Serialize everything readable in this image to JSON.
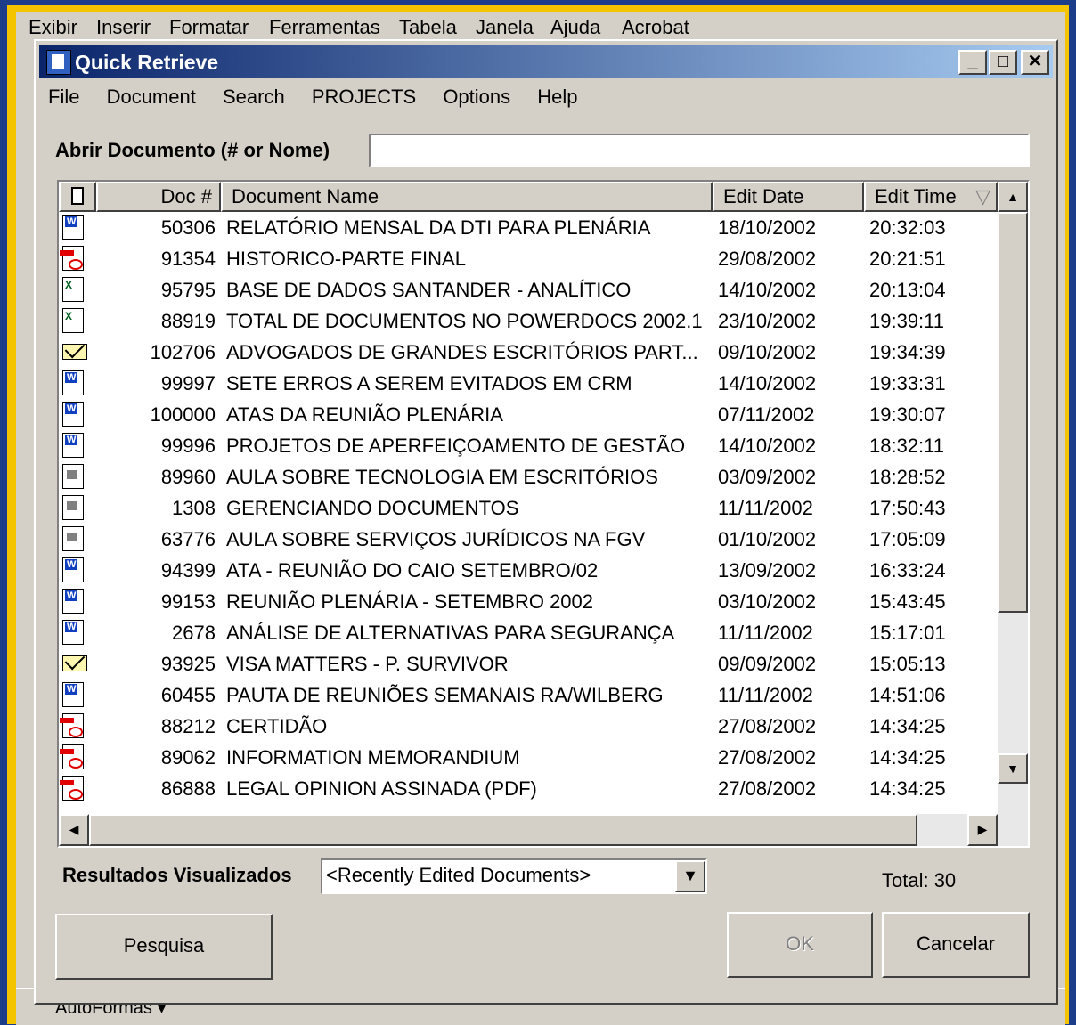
{
  "background": {
    "menu": [
      "Exibir",
      "Inserir",
      "Formatar",
      "Ferramentas",
      "Tabela",
      "Janela",
      "Ajuda",
      "Acrobat"
    ],
    "toolbar_label": "AutoFormas ▾"
  },
  "window": {
    "title": "Quick Retrieve",
    "minimize": "_",
    "maximize": "□",
    "close": "✕"
  },
  "menu": [
    "File",
    "Document",
    "Search",
    "PROJECTS",
    "Options",
    "Help"
  ],
  "open_field": {
    "label": "Abrir Documento (# or Nome)",
    "value": ""
  },
  "table": {
    "columns": [
      "Doc #",
      "Document Name",
      "Edit Date",
      "Edit Time"
    ],
    "sort_indicator": "▽",
    "rows": [
      {
        "icon": "word",
        "num": "50306",
        "name": "RELATÓRIO MENSAL DA DTI PARA PLENÁRIA",
        "date": "18/10/2002",
        "time": "20:32:03"
      },
      {
        "icon": "pdf",
        "num": "91354",
        "name": "HISTORICO-PARTE FINAL",
        "date": "29/08/2002",
        "time": "20:21:51"
      },
      {
        "icon": "xl",
        "num": "95795",
        "name": "BASE DE DADOS SANTANDER - ANALÍTICO",
        "date": "14/10/2002",
        "time": "20:13:04"
      },
      {
        "icon": "xl",
        "num": "88919",
        "name": "TOTAL DE DOCUMENTOS NO POWERDOCS 2002.1",
        "date": "23/10/2002",
        "time": "19:39:11"
      },
      {
        "icon": "mail",
        "num": "102706",
        "name": "ADVOGADOS DE GRANDES ESCRITÓRIOS PART...",
        "date": "09/10/2002",
        "time": "19:34:39"
      },
      {
        "icon": "word",
        "num": "99997",
        "name": "SETE ERROS A SEREM EVITADOS EM CRM",
        "date": "14/10/2002",
        "time": "19:33:31"
      },
      {
        "icon": "word",
        "num": "100000",
        "name": "ATAS DA REUNIÃO PLENÁRIA",
        "date": "07/11/2002",
        "time": "19:30:07"
      },
      {
        "icon": "word",
        "num": "99996",
        "name": "PROJETOS DE APERFEIÇOAMENTO DE GESTÃO",
        "date": "14/10/2002",
        "time": "18:32:11"
      },
      {
        "icon": "gen",
        "num": "89960",
        "name": "AULA SOBRE TECNOLOGIA EM ESCRITÓRIOS",
        "date": "03/09/2002",
        "time": "18:28:52"
      },
      {
        "icon": "gen",
        "num": "1308",
        "name": "GERENCIANDO DOCUMENTOS",
        "date": "11/11/2002",
        "time": "17:50:43"
      },
      {
        "icon": "gen",
        "num": "63776",
        "name": "AULA SOBRE SERVIÇOS JURÍDICOS NA FGV",
        "date": "01/10/2002",
        "time": "17:05:09"
      },
      {
        "icon": "word",
        "num": "94399",
        "name": "ATA - REUNIÃO DO CAIO SETEMBRO/02",
        "date": "13/09/2002",
        "time": "16:33:24"
      },
      {
        "icon": "word",
        "num": "99153",
        "name": "REUNIÃO PLENÁRIA - SETEMBRO 2002",
        "date": "03/10/2002",
        "time": "15:43:45"
      },
      {
        "icon": "word",
        "num": "2678",
        "name": "ANÁLISE DE ALTERNATIVAS PARA SEGURANÇA",
        "date": "11/11/2002",
        "time": "15:17:01"
      },
      {
        "icon": "mail",
        "num": "93925",
        "name": "VISA MATTERS - P. SURVIVOR",
        "date": "09/09/2002",
        "time": "15:05:13"
      },
      {
        "icon": "word",
        "num": "60455",
        "name": "PAUTA DE REUNIÕES SEMANAIS RA/WILBERG",
        "date": "11/11/2002",
        "time": "14:51:06"
      },
      {
        "icon": "pdf",
        "num": "88212",
        "name": "CERTIDÃO",
        "date": "27/08/2002",
        "time": "14:34:25"
      },
      {
        "icon": "pdf",
        "num": "89062",
        "name": "INFORMATION MEMORANDIUM",
        "date": "27/08/2002",
        "time": "14:34:25"
      },
      {
        "icon": "pdf",
        "num": "86888",
        "name": "LEGAL OPINION ASSINADA (PDF)",
        "date": "27/08/2002",
        "time": "14:34:25"
      }
    ]
  },
  "results": {
    "label": "Resultados Visualizados",
    "selected": "<Recently Edited Documents>",
    "total": "Total: 30"
  },
  "buttons": {
    "search": "Pesquisa",
    "ok": "OK",
    "cancel": "Cancelar"
  },
  "colors": {
    "title_start": "#0a246a",
    "title_end": "#a6caf0",
    "frame": "#f5c400",
    "desktop": "#1b3d8a"
  }
}
